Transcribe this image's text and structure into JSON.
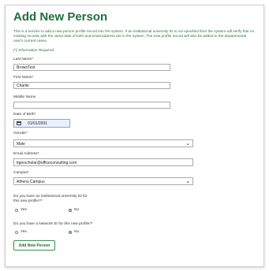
{
  "page": {
    "title": "Add New Person",
    "description": "This is a service to add a new person profile record into the system. If an institutional university ID is not specified then the system will verify that no existing records with the same date of birth and email address are in the system. The new profile record will also be added to the departmental user's current cases.",
    "required_note": "(*) Information Required"
  },
  "form": {
    "last_name_label": "Last Name*",
    "last_name_value": "BrownTest",
    "first_name_label": "First Name*",
    "first_name_value": "Charlie",
    "middle_name_label": "Middle Name",
    "middle_name_value": "",
    "dob_label": "Date of Birth*",
    "dob_value": "01/01/2001",
    "gender_label": "Gender*",
    "gender_value": "Male",
    "email_label": "Email Address*",
    "email_value": "tigerscholar@officeconsulting.com",
    "campus_label": "Campus*",
    "campus_value": "Athens Campus",
    "q1_line1": "Do you have an institutional university ID for",
    "q1_line2": "this new profile?*",
    "q1_yes": "Yes",
    "q1_no": "No",
    "q1_selected": "No",
    "q2_line1": "Do you have a Network ID for this new profile?*",
    "q2_yes": "Yes",
    "q2_no": "No",
    "q2_selected": "No",
    "submit_label": "Add New Person"
  },
  "icons": {
    "calendar": "calendar-icon",
    "dropdown": "chevron-down-icon"
  },
  "colors": {
    "heading": "#1f6e3c",
    "accent": "#3b73c4"
  }
}
